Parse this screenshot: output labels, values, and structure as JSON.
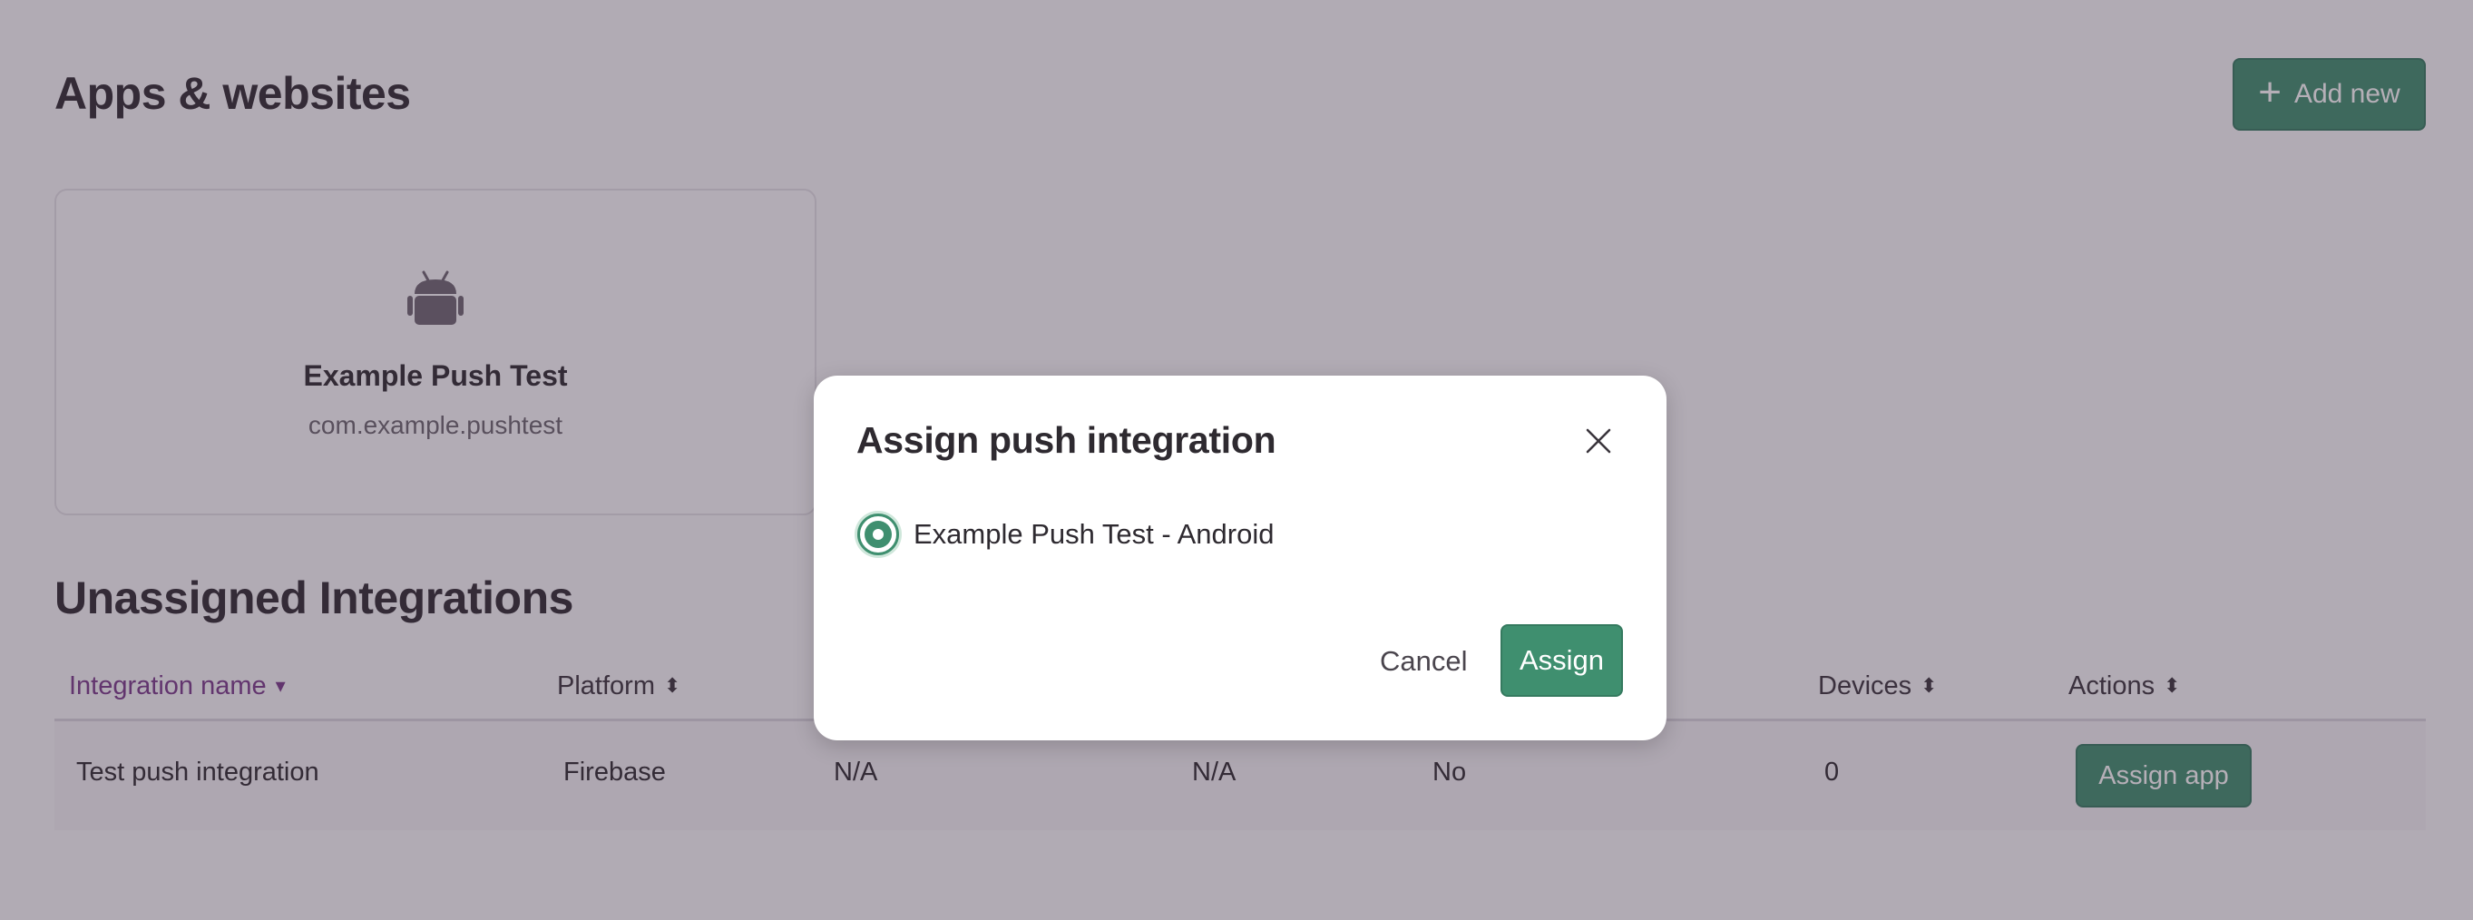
{
  "page": {
    "title": "Apps & websites",
    "add_new_label": "Add new"
  },
  "app_card": {
    "icon": "android-icon",
    "name": "Example Push Test",
    "bundle_id": "com.example.pushtest"
  },
  "unassigned": {
    "title": "Unassigned Integrations",
    "columns": [
      {
        "label": "Integration name",
        "sort": "caret-down"
      },
      {
        "label": "Platform",
        "sort": "sort-both"
      },
      {
        "label": "",
        "sort": ""
      },
      {
        "label": "",
        "sort": ""
      },
      {
        "label": "",
        "sort": ""
      },
      {
        "label": "Devices",
        "sort": "sort-both"
      },
      {
        "label": "Actions",
        "sort": "sort-both"
      }
    ],
    "rows": [
      {
        "name": "Test push integration",
        "platform": "Firebase",
        "col3": "N/A",
        "col4": "N/A",
        "col5": "No",
        "devices": "0",
        "action_label": "Assign app"
      }
    ]
  },
  "modal": {
    "title": "Assign push integration",
    "options": [
      {
        "label": "Example Push Test - Android",
        "selected": true
      }
    ],
    "cancel_label": "Cancel",
    "assign_label": "Assign"
  },
  "colors": {
    "primary_green": "#3f8f6f",
    "active_header": "#7a3a8a",
    "overlay": "rgba(60, 46, 66, 0.38)"
  }
}
